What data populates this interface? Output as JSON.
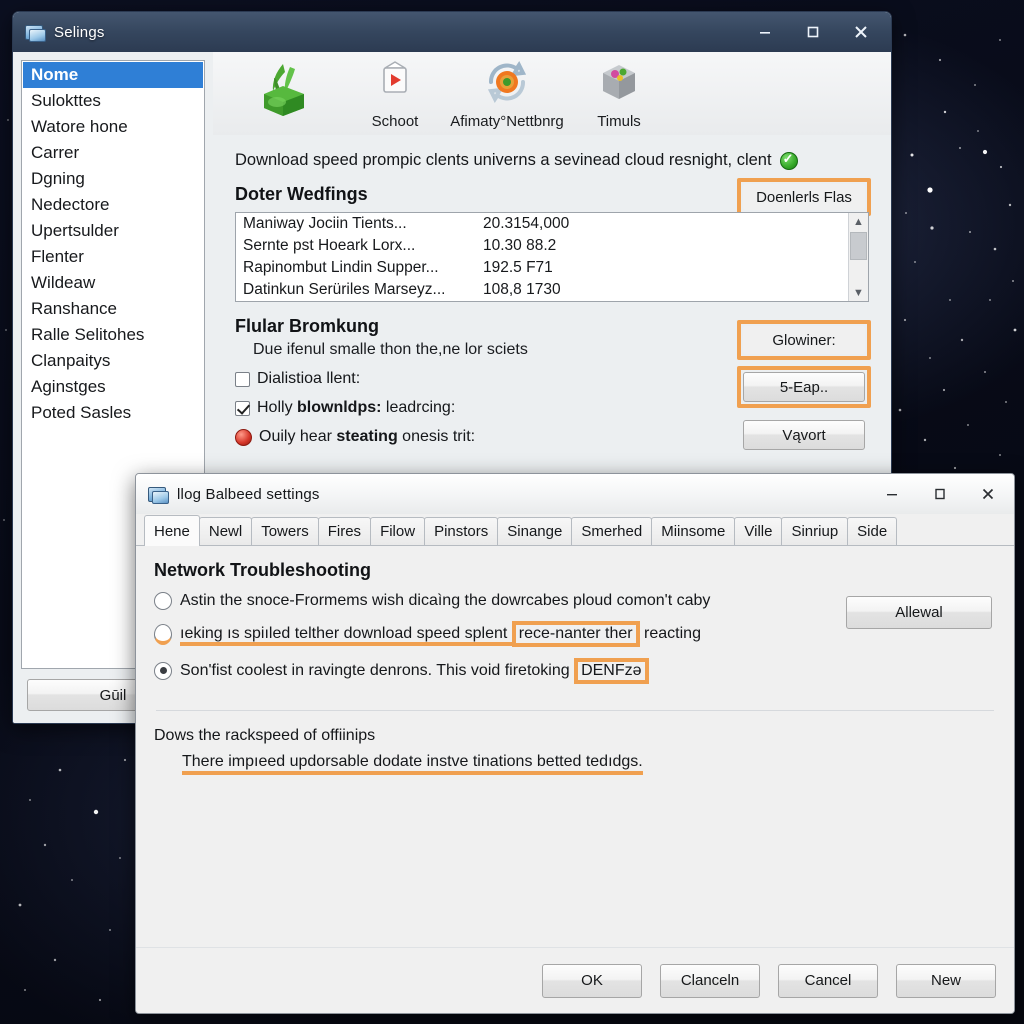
{
  "desktop": {
    "background": "#080b18",
    "accent": "#f0a050"
  },
  "settings_window": {
    "title": "Selings",
    "title_icon": "window-icon",
    "controls": {
      "minimize": "minimize-icon",
      "maximize": "maximize-icon",
      "close": "close-icon"
    },
    "sidebar": {
      "items": [
        "Nome",
        "Sulokttes",
        "Watore hone",
        "Carrer",
        "Dgning",
        "Nedectore",
        "Upertsulder",
        "Flenter",
        "Wildeaw",
        "Ranshance",
        "Ralle Selitohes",
        "Clanpaitys",
        "Aginstges",
        "Poted Sasles"
      ],
      "selected_index": 0,
      "bottom_button": "Gūil"
    },
    "toolbar": [
      {
        "label": "",
        "icon": "leaf-plant-icon"
      },
      {
        "label": "Schoot",
        "icon": "media-play-icon"
      },
      {
        "label": "Afimaty°Nettbnrg",
        "icon": "network-sync-icon"
      },
      {
        "label": "Timuls",
        "icon": "cube-box-icon"
      }
    ],
    "content": {
      "description": "Download speed prompic clents univerns a sevinead cloud resnight, clent",
      "status_icon": "green-check-icon",
      "section_title": "Doter Wedfings",
      "section_button": "Doenlerls Flas",
      "list_rows": [
        {
          "name": "Maniway Jociin Tients...",
          "value": "20.3154,000"
        },
        {
          "name": "Sernte pst Hoeark Lorx...",
          "value": "10.30 88.2"
        },
        {
          "name": "Rapinombut Lindin Supper...",
          "value": "192.5 F71"
        },
        {
          "name": "Datinkun Serüriles Marseyz...",
          "value": "108,8 1730"
        }
      ],
      "scroll": {
        "up": "scroll-up-arrow",
        "down": "scroll-down-arrow"
      },
      "section2_title": "Flular Bromkung",
      "section2_sub": "Due ifenul smalle thon the,ne lor sciets",
      "checkbox1": {
        "label": "Dialistioa llent:",
        "checked": false
      },
      "checkbox2": {
        "label_a": "Holly ",
        "label_b": "blownldps:",
        "label_c": " leadrcing:",
        "checked": true
      },
      "radio_red": {
        "label_a": "Ouily hear ",
        "label_b": "steating",
        "label_c": " onesis trit:"
      },
      "buttons": {
        "glowiner": "Glowiner:",
        "seap": "5-Eap..",
        "vavort": "Vąvort"
      }
    }
  },
  "dialog_window": {
    "title": "llog Balbeed settings",
    "title_icon": "window-icon",
    "controls": {
      "minimize": "minimize-icon",
      "maximize": "maximize-icon",
      "close": "close-icon"
    },
    "tabs": [
      "Hene",
      "Newl",
      "Towers",
      "Fires",
      "Filow",
      "Pinstors",
      "Sinange",
      "Smerhed",
      "Miinsome",
      "Ville",
      "Sinriup",
      "Side"
    ],
    "active_tab_index": 0,
    "content": {
      "heading": "Network Troubleshooting",
      "options": [
        {
          "text": "Astin the snoce-Frormems wish dicaìng the dowrcabes ploud comon't caby",
          "selected": false
        },
        {
          "text_a": "ıeking ıs spiıled telther download speed splent ",
          "text_hl": "rece-nanter ther",
          "text_b": " reacting",
          "selected": false
        },
        {
          "text_a": "Son'fist coolest in ravingte denrons. This void firetoking ",
          "text_hl": "DENFzə",
          "text_b": "",
          "selected": true
        }
      ],
      "side_button": "Allewal",
      "footer_heading": "Dows the rackspeed of offiinips",
      "footer_text": "There impıeed updorsable dodate instve tinations betted tedıdgs."
    },
    "buttons": [
      "OK",
      "Clanceln",
      "Cancel",
      "New"
    ]
  }
}
